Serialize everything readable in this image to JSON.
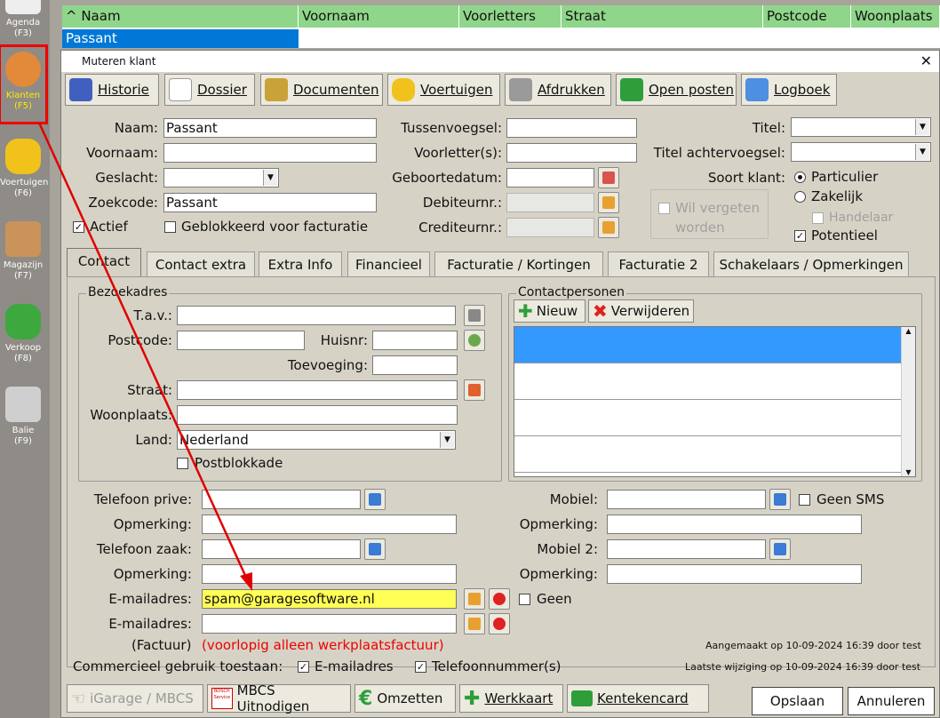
{
  "sidebar": {
    "items": [
      {
        "label": "Agenda",
        "key": "(F3)",
        "icon": "calendar-icon"
      },
      {
        "label": "Klanten",
        "key": "(F5)",
        "icon": "people-icon"
      },
      {
        "label": "Voertuigen",
        "key": "(F6)",
        "icon": "car-icon"
      },
      {
        "label": "Magazijn",
        "key": "(F7)",
        "icon": "box-icon"
      },
      {
        "label": "Verkoop",
        "key": "(F8)",
        "icon": "euro-car-icon"
      },
      {
        "label": "Balie",
        "key": "(F9)",
        "icon": "cash-register-icon"
      }
    ]
  },
  "grid": {
    "columns": [
      "^ Naam",
      "Voornaam",
      "Voorletters",
      "Straat",
      "Postcode",
      "Woonplaats"
    ],
    "row": [
      "Passant",
      "",
      "",
      "",
      "",
      ""
    ]
  },
  "dialog": {
    "title": "Muteren klant",
    "close": "✕",
    "toolbar": [
      "Historie",
      "Dossier",
      "Documenten",
      "Voertuigen",
      "Afdrukken",
      "Open posten",
      "Logboek"
    ],
    "labels": {
      "naam": "Naam:",
      "voornaam": "Voornaam:",
      "geslacht": "Geslacht:",
      "zoekcode": "Zoekcode:",
      "actief": "Actief",
      "geblokkeerd": "Geblokkeerd voor facturatie",
      "tussenvoegsel": "Tussenvoegsel:",
      "voorletters": "Voorletter(s):",
      "geboortedatum": "Geboortedatum:",
      "debiteurnr": "Debiteurnr.:",
      "crediteurnr": "Crediteurnr.:",
      "titel": "Titel:",
      "titel_achter": "Titel achtervoegsel:",
      "soort": "Soort klant:",
      "particulier": "Particulier",
      "zakelijk": "Zakelijk",
      "handelaar": "Handelaar",
      "potentieel": "Potentieel",
      "wil_vergeten": "Wil vergeten",
      "worden": "worden"
    },
    "values": {
      "naam": "Passant",
      "zoekcode": "Passant"
    },
    "tabs": [
      "Contact",
      "Contact extra",
      "Extra Info",
      "Financieel",
      "Facturatie / Kortingen",
      "Facturatie 2",
      "Schakelaars / Opmerkingen"
    ],
    "contact": {
      "bezoekadres": "Bezoekadres",
      "tav": "T.a.v.:",
      "postcode": "Postcode:",
      "huisnr": "Huisnr:",
      "toevoeging": "Toevoeging:",
      "straat": "Straat:",
      "woonplaats": "Woonplaats:",
      "land": "Land:",
      "land_value": "Nederland",
      "postblokkade": "Postblokkade",
      "contactpersonen": "Contactpersonen",
      "nieuw": "Nieuw",
      "verwijderen": "Verwijderen",
      "tel_prive": "Telefoon prive:",
      "opmerking": "Opmerking:",
      "tel_zaak": "Telefoon zaak:",
      "email": "E-mailadres:",
      "email_value": "spam@garagesoftware.nl",
      "mobiel": "Mobiel:",
      "geen_sms": "Geen SMS",
      "mobiel2": "Mobiel 2:",
      "geen": "Geen",
      "factuur": "(Factuur)",
      "factuur_note": "(voorlopig alleen werkplaatsfactuur)",
      "aangemaakt": "Aangemaakt op 10-09-2024 16:39 door test",
      "gewijzigd": "Laatste wijziging op 10-09-2024 16:39 door test",
      "commercieel": "Commercieel gebruik toestaan:",
      "c_email": "E-mailadres",
      "c_tel": "Telefoonnummer(s)"
    },
    "bottom": {
      "igarage": "iGarage / MBCS",
      "mbcs": "MBCS Uitnodigen",
      "omzetten": "Omzetten",
      "werkkaart": "Werkkaart",
      "kentekencard": "Kentekencard",
      "opslaan": "Opslaan",
      "annuleren": "Annuleren",
      "bosch": "BOSCH Service"
    }
  },
  "colors": {
    "grid_header": "#8fd68a",
    "selection": "#0078d7",
    "highlight": "#ffff55",
    "annotation": "#e00000"
  }
}
